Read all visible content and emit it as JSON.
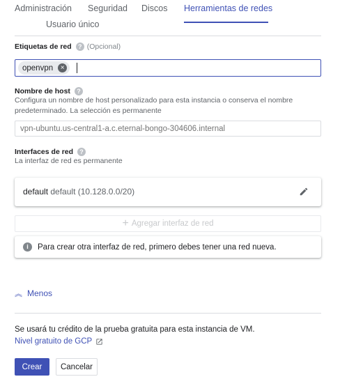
{
  "tabs": [
    {
      "label": "Administración",
      "active": false
    },
    {
      "label": "Seguridad",
      "active": false
    },
    {
      "label": "Discos",
      "active": false
    },
    {
      "label": "Herramientas de redes",
      "active": true
    }
  ],
  "tab_row2": {
    "label": "Usuario único"
  },
  "network_tags": {
    "label": "Etiquetas de red",
    "optional": "(Opcional)",
    "chips": [
      "openvpn"
    ]
  },
  "hostname": {
    "label": "Nombre de host",
    "description": "Configura un nombre de host personalizado para esta instancia o conserva el nombre predeterminado. La selección es permanente",
    "placeholder": "vpn-ubuntu.us-central1-a.c.eternal-bongo-304606.internal"
  },
  "interfaces": {
    "label": "Interfaces de red",
    "description": "La interfaz de red es permanente",
    "items": [
      {
        "name": "default",
        "detail": "default (10.128.0.0/20)"
      }
    ],
    "add_label": "Agregar interfaz de red",
    "info_text": "Para crear otra interfaz de red, primero debes tener una red nueva."
  },
  "less_label": "Menos",
  "credit_text": "Se usará tu crédito de la prueba gratuita para esta instancia de VM.",
  "gcp_link": "Nivel gratuito de GCP",
  "actions": {
    "create": "Crear",
    "cancel": "Cancelar"
  },
  "colors": {
    "accent": "#3f51b5"
  },
  "icons": {
    "help": "help-circle-icon",
    "chip_close": "close-circle-icon",
    "edit": "pencil-icon",
    "add": "plus-icon",
    "info": "info-icon",
    "less": "chevron-double-up-icon",
    "external": "external-link-icon"
  }
}
